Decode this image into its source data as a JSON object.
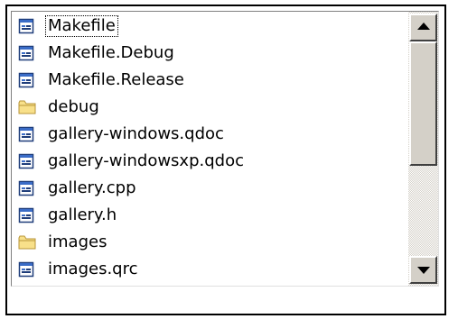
{
  "files": [
    {
      "label": "Makefile",
      "icon": "file-icon",
      "focused": true
    },
    {
      "label": "Makefile.Debug",
      "icon": "file-icon"
    },
    {
      "label": "Makefile.Release",
      "icon": "file-icon"
    },
    {
      "label": "debug",
      "icon": "folder-icon"
    },
    {
      "label": "gallery-windows.qdoc",
      "icon": "file-icon"
    },
    {
      "label": "gallery-windowsxp.qdoc",
      "icon": "file-icon"
    },
    {
      "label": "gallery.cpp",
      "icon": "file-icon"
    },
    {
      "label": "gallery.h",
      "icon": "file-icon"
    },
    {
      "label": "images",
      "icon": "folder-icon"
    },
    {
      "label": "images.qrc",
      "icon": "file-icon"
    }
  ],
  "colors": {
    "file_icon_border": "#1f3d7a",
    "file_icon_bar": "#3a6cc7",
    "folder_fill": "#f8e08a",
    "folder_border": "#b8963a"
  },
  "scrollbar": {
    "visible_fraction": 0.5,
    "position_fraction": 0.0
  }
}
